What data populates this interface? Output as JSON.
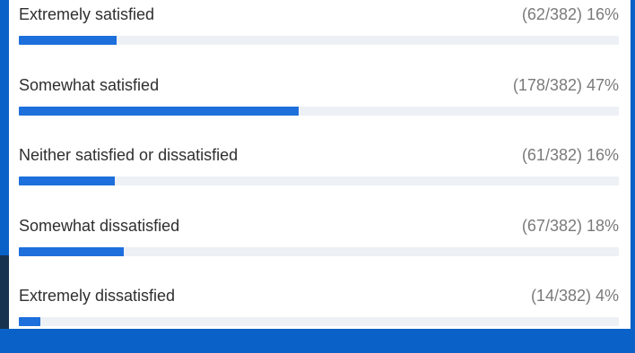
{
  "poll": {
    "accent_color": "#1d6fdc",
    "track_color": "#edf0f4",
    "background_color": "#0a61c7",
    "results": [
      {
        "label": "Extremely satisfied",
        "stat": "(62/382) 16%",
        "votes": 62,
        "total": 382,
        "percent": 16
      },
      {
        "label": "Somewhat satisfied",
        "stat": "(178/382) 47%",
        "votes": 178,
        "total": 382,
        "percent": 47
      },
      {
        "label": "Neither satisfied or dissatisfied",
        "stat": "(61/382) 16%",
        "votes": 61,
        "total": 382,
        "percent": 16
      },
      {
        "label": "Somewhat dissatisfied",
        "stat": "(67/382) 18%",
        "votes": 67,
        "total": 382,
        "percent": 18
      },
      {
        "label": "Extremely dissatisfied",
        "stat": "(14/382) 4%",
        "votes": 14,
        "total": 382,
        "percent": 4
      }
    ]
  }
}
